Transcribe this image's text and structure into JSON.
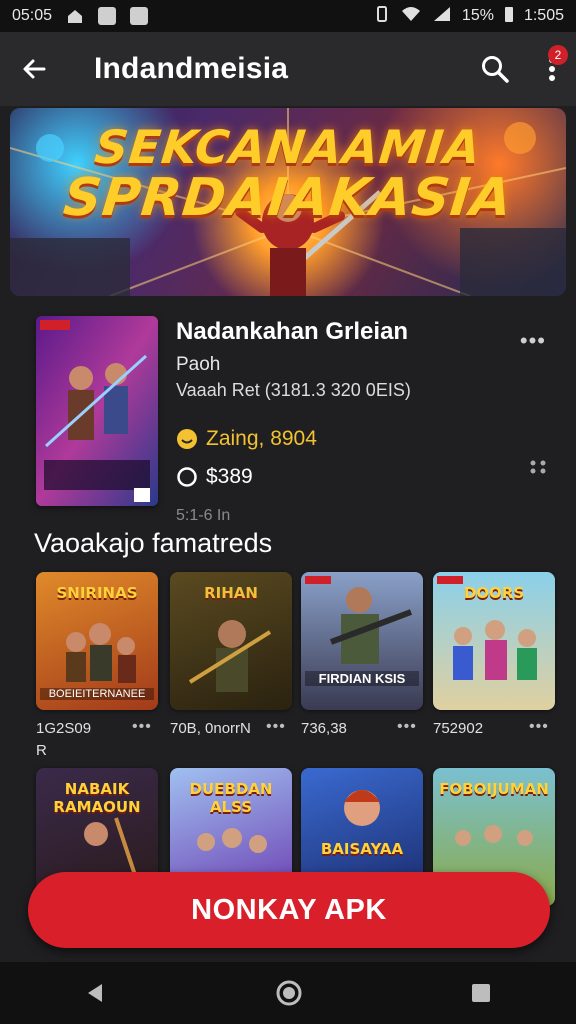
{
  "status_bar": {
    "time": "05:05",
    "battery": "15%",
    "clock_right": "1:505"
  },
  "app_bar": {
    "title": "Indandmeisia",
    "notification_count": "2"
  },
  "banner": {
    "title_line1": "SEKCANAAMIA",
    "title_line2": "SPRDAIAKASIA"
  },
  "game": {
    "title": "Nadankahan Grleian",
    "subtitle": "Paoh",
    "version": "Vaaah Ret (3181.3 320 0EIS)",
    "rating": "Zaing, 8904",
    "price": "$389",
    "size": "5:1-6 In"
  },
  "section": {
    "title": "Vaoakajo famatreds"
  },
  "tiles": [
    {
      "title": "SNIRINAS",
      "caption": "BOEIEITERNANEE",
      "meta": "1G2S09",
      "meta2": "R",
      "bg": "#c4561c"
    },
    {
      "title": "RIHAN",
      "caption": "",
      "meta": "70B, 0norrN",
      "meta2": "",
      "bg": "#3e3a20"
    },
    {
      "title": "",
      "caption": "FIRDIAN KSIS",
      "meta": "736,38",
      "meta2": "",
      "bg": "#3c3a52"
    },
    {
      "title": "DOORS",
      "caption": "",
      "meta": "752902",
      "meta2": "",
      "bg": "#6ab0cc"
    },
    {
      "title": "NABAIK RAMAOUN",
      "caption": "",
      "meta": "",
      "meta2": "",
      "bg": "#3a2a22"
    },
    {
      "title": "DUEBDAN ALSS",
      "caption": "",
      "meta": "",
      "meta2": "",
      "bg": "#5a6ad0"
    },
    {
      "title": "BAISAYAA",
      "caption": "",
      "meta": "",
      "meta2": "",
      "bg": "#2a5aa0"
    },
    {
      "title": "FOBOIJUMAN",
      "caption": "",
      "meta": "",
      "meta2": "",
      "bg": "#7a9a4a"
    }
  ],
  "install_button": {
    "label": "NONKAY APK"
  },
  "colors": {
    "accent": "#d9202a",
    "rating": "#f2c230",
    "background": "#1f1f21"
  }
}
